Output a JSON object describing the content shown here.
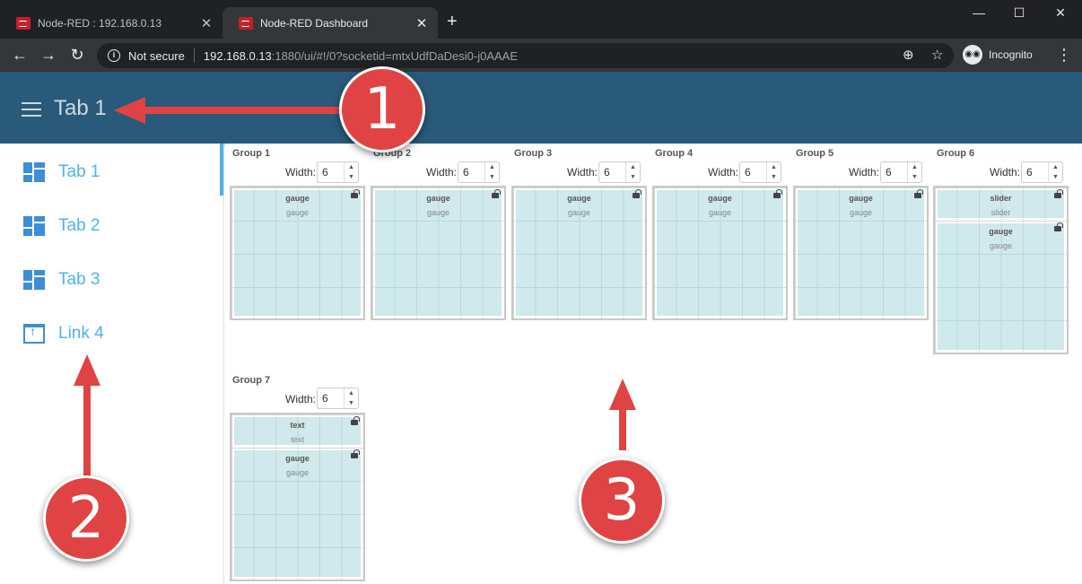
{
  "browser": {
    "tabs": [
      {
        "title": "Node-RED : 192.168.0.13",
        "close": "✕"
      },
      {
        "title": "Node-RED Dashboard",
        "close": "✕"
      }
    ],
    "new_tab": "+",
    "window_controls": {
      "minimize": "—",
      "maximize": "☐",
      "close": "✕"
    },
    "nav": {
      "back": "←",
      "forward": "→",
      "reload": "↻"
    },
    "security_label": "Not secure",
    "url_host": "192.168.0.13",
    "url_rest": ":1880/ui/#!/0?socketid=mtxUdfDaDesi0-j0AAAE",
    "incognito_label": "Incognito",
    "menu": "⋮"
  },
  "header": {
    "title": "Tab 1"
  },
  "sidebar": {
    "items": [
      {
        "label": "Tab 1",
        "icon": "dashboard-icon"
      },
      {
        "label": "Tab 2",
        "icon": "dashboard-icon"
      },
      {
        "label": "Tab 3",
        "icon": "dashboard-icon"
      },
      {
        "label": "Link 4",
        "icon": "open-in-new-icon"
      }
    ]
  },
  "main": {
    "width_label": "Width:",
    "groups": [
      {
        "title": "Group 1",
        "width": "6",
        "widgets": [
          {
            "name": "gauge",
            "type": "gauge"
          }
        ]
      },
      {
        "title": "Group 2",
        "width": "6",
        "widgets": [
          {
            "name": "gauge",
            "type": "gauge"
          }
        ]
      },
      {
        "title": "Group 3",
        "width": "6",
        "widgets": [
          {
            "name": "gauge",
            "type": "gauge"
          }
        ]
      },
      {
        "title": "Group 4",
        "width": "6",
        "widgets": [
          {
            "name": "gauge",
            "type": "gauge"
          }
        ]
      },
      {
        "title": "Group 5",
        "width": "6",
        "widgets": [
          {
            "name": "gauge",
            "type": "gauge"
          }
        ]
      },
      {
        "title": "Group 6",
        "width": "6",
        "widgets": [
          {
            "name": "slider",
            "type": "slider"
          },
          {
            "name": "gauge",
            "type": "gauge"
          }
        ]
      },
      {
        "title": "Group 7",
        "width": "6",
        "widgets": [
          {
            "name": "text",
            "type": "text"
          },
          {
            "name": "gauge",
            "type": "gauge"
          }
        ]
      }
    ]
  },
  "annotations": [
    "1",
    "2",
    "3"
  ],
  "colors": {
    "header": "#295a7a",
    "accent": "#4fb3e8",
    "callout": "#e04343",
    "widget": "#c5e6ea"
  }
}
